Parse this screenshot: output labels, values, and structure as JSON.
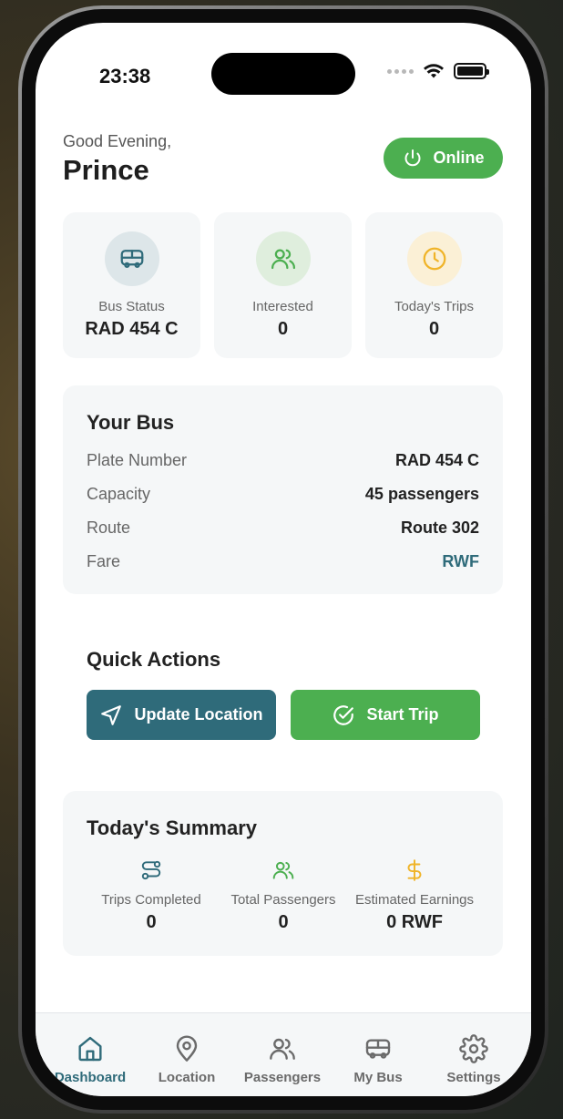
{
  "status_bar": {
    "time": "23:38"
  },
  "header": {
    "greeting": "Good Evening,",
    "name": "Prince",
    "online_label": "Online"
  },
  "stats": [
    {
      "icon": "bus-icon",
      "label": "Bus Status",
      "value": "RAD 454 C"
    },
    {
      "icon": "users-icon",
      "label": "Interested",
      "value": "0"
    },
    {
      "icon": "clock-icon",
      "label": "Today's Trips",
      "value": "0"
    }
  ],
  "your_bus": {
    "title": "Your Bus",
    "rows": [
      {
        "key": "Plate Number",
        "value": "RAD 454 C"
      },
      {
        "key": "Capacity",
        "value": "45 passengers"
      },
      {
        "key": "Route",
        "value": "Route 302"
      },
      {
        "key": "Fare",
        "value": "RWF"
      }
    ]
  },
  "quick_actions": {
    "title": "Quick Actions",
    "update_location": "Update Location",
    "start_trip": "Start Trip"
  },
  "summary": {
    "title": "Today's Summary",
    "items": [
      {
        "icon": "route-icon",
        "label": "Trips Completed",
        "value": "0"
      },
      {
        "icon": "users-icon",
        "label": "Total Passengers",
        "value": "0"
      },
      {
        "icon": "dollar-icon",
        "label": "Estimated Earnings",
        "value": "0 RWF"
      }
    ]
  },
  "tabs": [
    {
      "icon": "home-icon",
      "label": "Dashboard",
      "active": true
    },
    {
      "icon": "map-pin-icon",
      "label": "Location",
      "active": false
    },
    {
      "icon": "users-icon",
      "label": "Passengers",
      "active": false
    },
    {
      "icon": "bus-icon",
      "label": "My Bus",
      "active": false
    },
    {
      "icon": "gear-icon",
      "label": "Settings",
      "active": false
    }
  ],
  "colors": {
    "primary_teal": "#2f6b7a",
    "primary_green": "#4caf50",
    "amber": "#f0b429",
    "card_bg": "#f5f7f8"
  }
}
